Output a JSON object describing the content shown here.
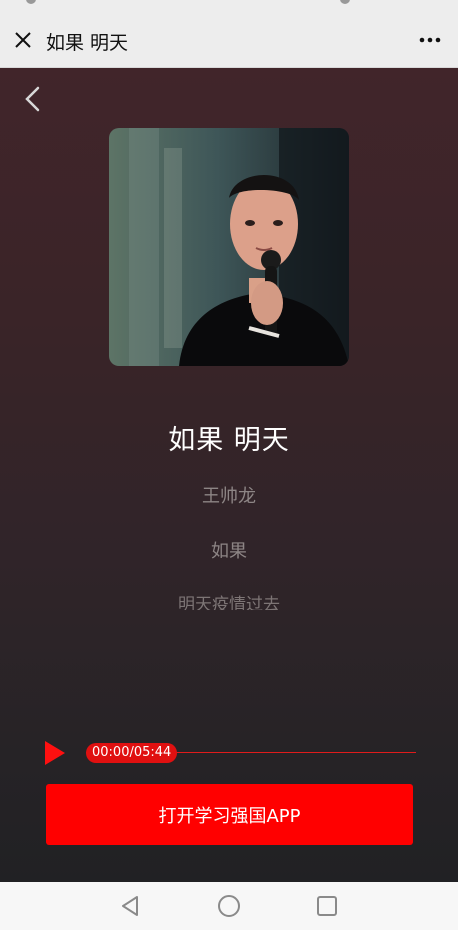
{
  "top_bar": {
    "title": "如果 明天",
    "close_icon": "close-icon",
    "more_icon": "more-icon"
  },
  "player": {
    "back_icon": "chevron-left-icon",
    "song_title": "如果 明天",
    "artist": "王帅龙",
    "lyrics": [
      "如果",
      "明天疫情过去"
    ],
    "time_display": "00:00/05:44",
    "progress": 0,
    "open_app_label": "打开学习强国APP",
    "accent_color": "#ff0000"
  },
  "nav_bar": {
    "icons": [
      "back-triangle-icon",
      "home-circle-icon",
      "recents-square-icon"
    ]
  }
}
